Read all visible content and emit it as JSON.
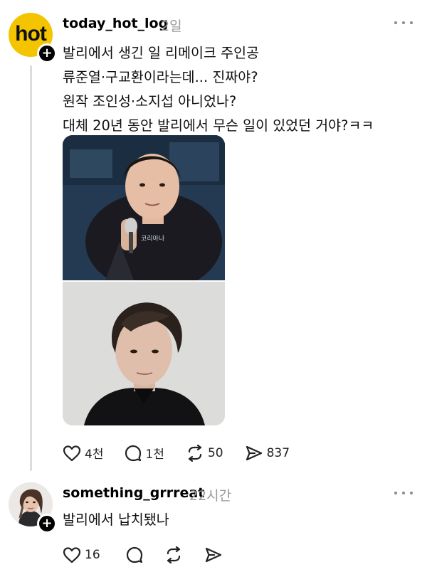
{
  "post": {
    "avatar_text": "hot",
    "username": "today_hot_log",
    "time": "2일",
    "lines": [
      "발리에서 생긴 일 리메이크 주인공",
      "류준열·구교환이라는데... 진짜야?",
      "원작 조인성·소지섭 아니었나?",
      "대체 20년 동안 발리에서 무슨 일이 있었던 거야?ㅋㅋ"
    ],
    "actions": {
      "likes": "4천",
      "comments": "1천",
      "reposts": "50",
      "shares": "837"
    }
  },
  "reply": {
    "username": "something_grrreat",
    "time": "22시간",
    "text": "발리에서 납치됐나",
    "actions": {
      "likes": "16"
    }
  },
  "colors": {
    "hot_avatar": "#f5c400",
    "muted_text": "#9a9a9a",
    "icon": "#222222"
  }
}
